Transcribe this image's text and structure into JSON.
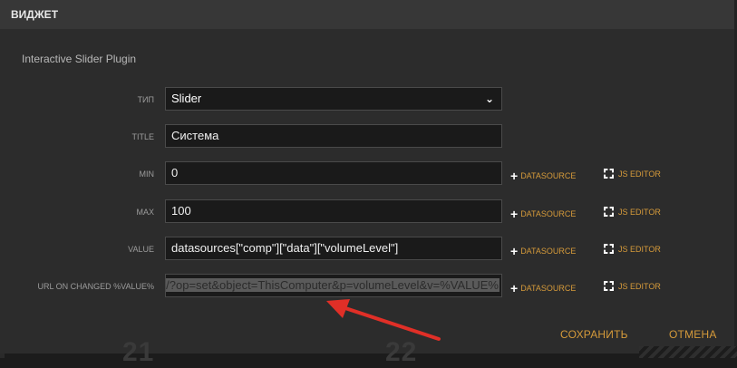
{
  "header": {
    "title": "ВИДЖЕТ"
  },
  "plugin_name": "Interactive Slider Plugin",
  "fields": {
    "type": {
      "label": "ТИП",
      "value": "Slider"
    },
    "title": {
      "label": "TITLE",
      "value": "Система"
    },
    "min": {
      "label": "MIN",
      "value": "0"
    },
    "max": {
      "label": "MAX",
      "value": "100"
    },
    "value": {
      "label": "VALUE",
      "value": "datasources[\"comp\"][\"data\"][\"volumeLevel\"]"
    },
    "url": {
      "label": "URL ON CHANGED %VALUE%",
      "value": "cts/?op=set&object=ThisComputer&p=volumeLevel&v=%VALUE%"
    }
  },
  "actions": {
    "datasource": "DATASOURCE",
    "js_editor": "JS EDITOR"
  },
  "footer": {
    "save": "СОХРАНИТЬ",
    "cancel": "ОТМЕНА"
  },
  "background_numbers": [
    "21",
    "22"
  ],
  "icons": {
    "add": "plus-icon",
    "editor": "expand-icon",
    "dropdown": "chevron-down-icon",
    "annotation": "red-arrow"
  },
  "colors": {
    "accent": "#d59a3a",
    "header_bg": "#373737",
    "modal_bg": "#2c2c2c",
    "arrow": "#e02f27"
  }
}
